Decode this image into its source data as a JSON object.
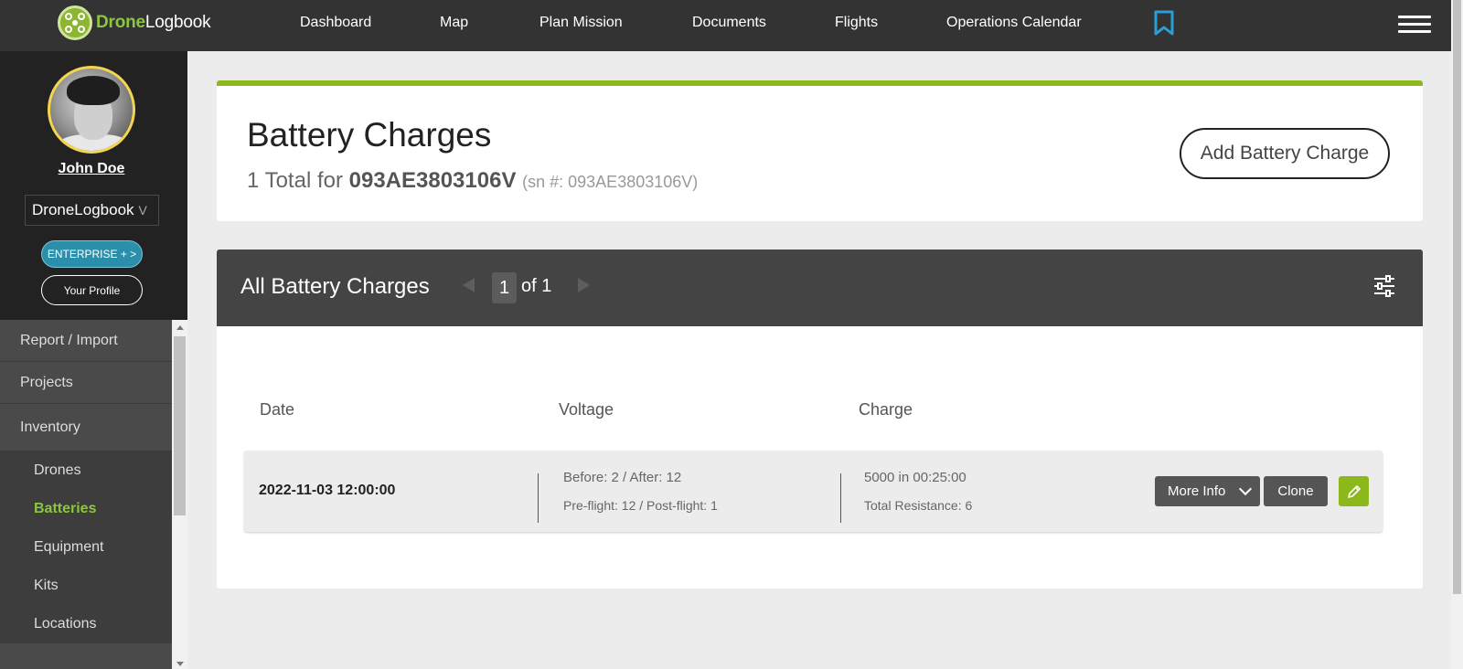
{
  "app": {
    "logo_drone": "Drone",
    "logo_logbook": "Logbook"
  },
  "nav": {
    "items": [
      "Dashboard",
      "Map",
      "Plan Mission",
      "Documents",
      "Flights",
      "Operations Calendar"
    ]
  },
  "colors": {
    "brand_green": "#8cb81c",
    "enterprise_blue": "#2b8fab",
    "bookmark_blue": "#2a9fd6",
    "topbar": "#333333"
  },
  "profile": {
    "name": "John Doe",
    "org": "DroneLogbook",
    "org_chevron": "V",
    "enterprise_label": "ENTERPRISE + >",
    "profile_label": "Your Profile"
  },
  "sidebar": {
    "sections": [
      "Report / Import",
      "Projects",
      "Inventory"
    ],
    "inventory_items": [
      "Drones",
      "Batteries",
      "Equipment",
      "Kits",
      "Locations"
    ],
    "active": "Batteries"
  },
  "header": {
    "title": "Battery Charges",
    "count_prefix": "1 Total for",
    "serial": "093AE3803106V",
    "sn_text": "(sn #: 093AE3803106V)",
    "add_button": "Add Battery Charge"
  },
  "list": {
    "title": "All Battery Charges",
    "page": "1",
    "of_text": "of 1",
    "columns": [
      "Date",
      "Voltage",
      "Charge"
    ],
    "rows": [
      {
        "date": "2022-11-03 12:00:00",
        "voltage_main": "Before: 2 / After: 12",
        "voltage_sub": "Pre-flight: 12 / Post-flight: 1",
        "charge_main": "5000 in 00:25:00",
        "charge_sub": "Total Resistance: 6",
        "more_info": "More Info",
        "clone": "Clone"
      }
    ]
  },
  "icons": [
    "drone-logo-icon",
    "bookmark-icon",
    "hamburger-menu-icon",
    "filter-sliders-icon",
    "pencil-edit-icon",
    "prev-page-icon",
    "next-page-icon",
    "chevron-down-icon"
  ]
}
